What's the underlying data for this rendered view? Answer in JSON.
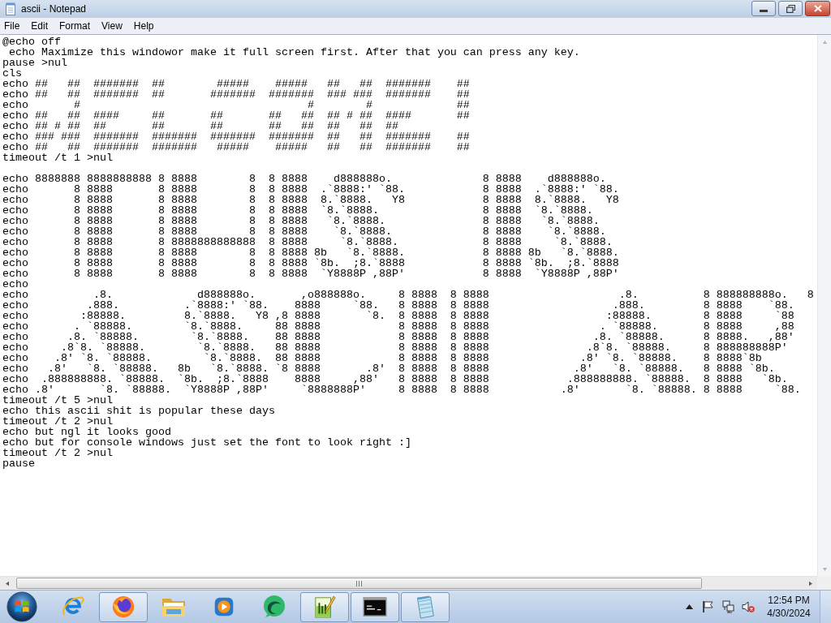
{
  "window": {
    "title": "ascii - Notepad"
  },
  "menu": [
    {
      "label": "File"
    },
    {
      "label": "Edit"
    },
    {
      "label": "Format"
    },
    {
      "label": "View"
    },
    {
      "label": "Help"
    }
  ],
  "document": {
    "blocks": [
      {
        "lines": [
          "@echo off",
          " echo Maximize this windowor make it full screen first. After that you can press any key.",
          "pause >nul",
          "cls",
          "echo ##   ##  #######  ##        #####    #####   ##   ##  #######    ##",
          "echo ##   ##  #######  ##       #######  #######  ### ###  #######    ##",
          "echo       #                                   #        #             ##",
          "echo ##   ##  ####     ##       ##       ##   ##  ## # ##  ####       ##",
          "echo ## # ##  ##       ##       ##       ##   ##  ##   ##  ##",
          "echo ### ###  #######  #######  #######  #######  ##   ##  #######    ##",
          "echo ##   ##  #######  #######   #####    #####   ##   ##  #######    ##",
          "timeout /t 1 >nul"
        ]
      },
      {
        "lines": [
          "echo 8888888 8888888888 8 8888        8  8 8888    d888888o.              8 8888    d888888o.",
          "echo       8 8888       8 8888        8  8 8888  .`8888:' `88.            8 8888  .`8888:' `88.",
          "echo       8 8888       8 8888        8  8 8888  8.`8888.   Y8            8 8888  8.`8888.   Y8",
          "echo       8 8888       8 8888        8  8 8888  `8.`8888.                8 8888  `8.`8888.",
          "echo       8 8888       8 8888        8  8 8888   `8.`8888.               8 8888   `8.`8888.",
          "echo       8 8888       8 8888        8  8 8888    `8.`8888.              8 8888    `8.`8888.",
          "echo       8 8888       8 8888888888888  8 8888     `8.`8888.             8 8888     `8.`8888.",
          "echo       8 8888       8 8888        8  8 8888 8b   `8.`8888.            8 8888 8b   `8.`8888.",
          "echo       8 8888       8 8888        8  8 8888 `8b.  ;8.`8888            8 8888 `8b.  ;8.`8888",
          "echo       8 8888       8 8888        8  8 8888  `Y8888P ,88P'            8 8888  `Y8888P ,88P'",
          "echo",
          "echo          .8.             d888888o.       ,o888888o.     8 8888  8 8888                    .8.          8 888888888o.   8",
          "echo         .888.          .`8888:' `88.    8888     `88.   8 8888  8 8888                   .888.         8 8888    `88.",
          "echo        :88888.         8.`8888.   Y8 ,8 8888       `8.  8 8888  8 8888                  :88888.        8 8888     `88",
          "echo       . `88888.        `8.`8888.     88 8888            8 8888  8 8888                 . `88888.       8 8888     ,88",
          "echo      .8. `88888.        `8.`8888.    88 8888            8 8888  8 8888                .8. `88888.      8 8888.   ,88'",
          "echo     .8`8. `88888.        `8.`8888.   88 8888            8 8888  8 8888               .8`8. `88888.     8 888888888P'",
          "echo    .8' `8. `88888.        `8.`8888.  88 8888            8 8888  8 8888              .8' `8. `88888.    8 8888`8b",
          "echo   .8'   `8. `88888.   8b   `8.`8888. `8 8888       .8'  8 8888  8 8888             .8'   `8. `88888.   8 8888 `8b.",
          "echo  .888888888. `88888.  `8b.  ;8.`8888    8888     ,88'   8 8888  8 8888            .888888888. `88888.  8 8888   `8b.",
          "echo .8'       `8. `88888.  `Y8888P ,88P'     `8888888P'     8 8888  8 8888           .8'       `8. `88888. 8 8888     `88.",
          "timeout /t 5 >nul",
          "echo this ascii shit is popular these days",
          "timeout /t 2 >nul",
          "echo but ngl it looks good",
          "echo but for console windows just set the font to look right :]",
          "timeout /t 2 >nul",
          "pause"
        ]
      }
    ]
  },
  "taskbar": {
    "apps": [
      {
        "kind": "ie",
        "running": false
      },
      {
        "kind": "firefox",
        "running": true
      },
      {
        "kind": "folder",
        "running": false
      },
      {
        "kind": "player",
        "running": false
      },
      {
        "kind": "bubble",
        "running": false
      },
      {
        "kind": "editor",
        "running": true
      },
      {
        "kind": "console",
        "running": true
      },
      {
        "kind": "notepad",
        "running": true
      }
    ],
    "clock": {
      "time": "12:54 PM",
      "date": "4/30/2024"
    }
  }
}
